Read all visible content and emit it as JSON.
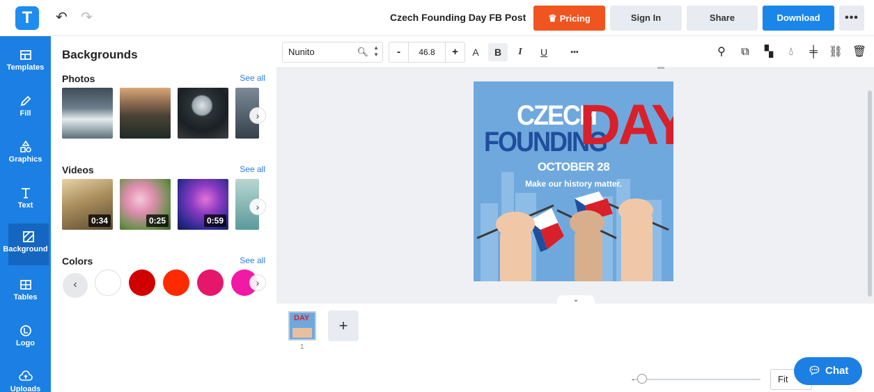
{
  "app": {
    "logo_letter": "T",
    "document_title": "Czech Founding Day FB Post"
  },
  "header": {
    "pricing_label": "Pricing",
    "signin_label": "Sign In",
    "share_label": "Share",
    "download_label": "Download",
    "more_label": "•••"
  },
  "sidebar": {
    "items": [
      {
        "label": "Templates",
        "icon": "templates-icon"
      },
      {
        "label": "Fill",
        "icon": "pencil-icon"
      },
      {
        "label": "Graphics",
        "icon": "shapes-icon"
      },
      {
        "label": "Text",
        "icon": "text-icon"
      },
      {
        "label": "Background",
        "icon": "background-icon",
        "active": true
      },
      {
        "label": "Tables",
        "icon": "table-icon"
      },
      {
        "label": "Logo",
        "icon": "logo-icon"
      },
      {
        "label": "Uploads",
        "icon": "cloud-upload-icon"
      }
    ]
  },
  "panel": {
    "title": "Backgrounds",
    "photos": {
      "title": "Photos",
      "see_all": "See all"
    },
    "videos": {
      "title": "Videos",
      "see_all": "See all",
      "durations": [
        "0:34",
        "0:25",
        "0:59"
      ]
    },
    "colors": {
      "title": "Colors",
      "see_all": "See all",
      "swatches": [
        "#ffffff",
        "#d10000",
        "#ff2a00",
        "#e4176b",
        "#f01aa6"
      ]
    }
  },
  "toolbar": {
    "font_name": "Nunito",
    "font_size": "46.8",
    "minus": "-",
    "plus": "+",
    "text_color": "A",
    "bold": "B",
    "italic": "I",
    "underline": "U",
    "more": "•••"
  },
  "design": {
    "word_czech": "CZECH",
    "word_founding": "FOUNDING",
    "word_day": "DAY",
    "date": "OCTOBER 28",
    "slogan": "Make our history matter."
  },
  "pages": {
    "thumb_word": "DAY",
    "page_number": "1",
    "add_label": "+"
  },
  "footer": {
    "zoom_mode": "Fit",
    "chat_label": "Chat"
  },
  "colors": {
    "accent_blue": "#1c7fe4",
    "pricing_orange": "#f0541f",
    "canvas_bg": "#6fa8dd",
    "czech_red": "#d8202a",
    "czech_blue": "#1f4e9c"
  }
}
